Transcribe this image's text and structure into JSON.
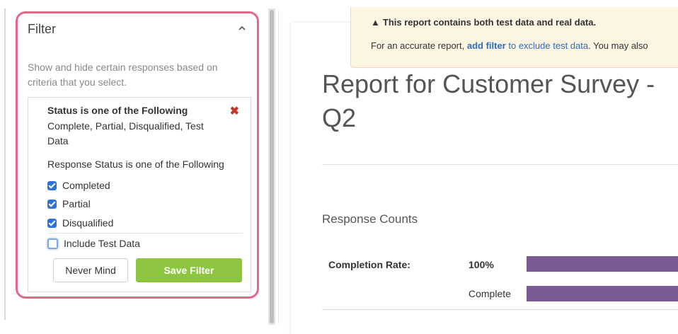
{
  "filter": {
    "header": "Filter",
    "collapse_icon": "chevron-up-icon",
    "description": "Show and hide certain responses based on criteria that you select.",
    "rule": {
      "title": "Status is one of the Following",
      "values": "Complete, Partial, Disqualified, Test Data",
      "remove_icon": "close-icon",
      "label": "Response Status is one of the Following",
      "options": [
        {
          "label": "Completed",
          "checked": true
        },
        {
          "label": "Partial",
          "checked": true
        },
        {
          "label": "Disqualified",
          "checked": true
        },
        {
          "label": "Include Test Data",
          "checked": false
        }
      ]
    },
    "buttons": {
      "cancel_label": "Never Mind",
      "save_label": "Save Filter"
    },
    "accent_colors": {
      "panel_border": "#e8658a",
      "save_button": "#8cc63f",
      "checkbox": "#2e74d8"
    }
  },
  "warning": {
    "icon": "warning-triangle-icon",
    "title": "This report contains both test data and real data.",
    "body_prefix": "For an accurate report, ",
    "link1": "add filter",
    "link2": " to exclude test data",
    "body_suffix": ". You may also"
  },
  "report": {
    "title": "Report for Customer Survey - Q2",
    "section_title": "Response Counts",
    "metric_label": "Completion Rate:",
    "metric_value": "100%",
    "bar_label": "Complete",
    "bar_color": "#7b5b93"
  }
}
